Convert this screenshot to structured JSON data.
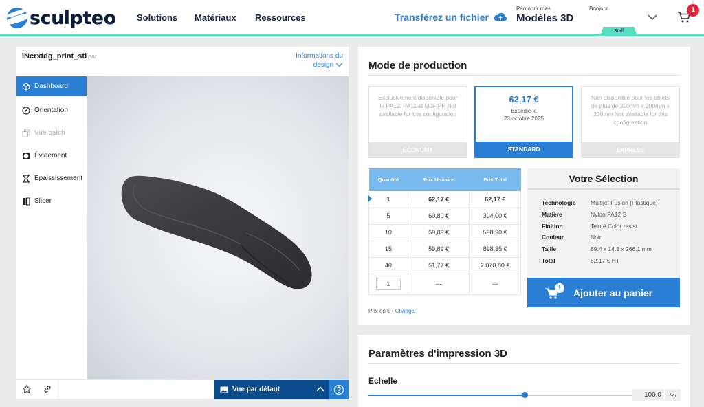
{
  "header": {
    "brand": "sculpteo",
    "nav": [
      "Solutions",
      "Matériaux",
      "Ressources"
    ],
    "upload_label": "Transférez un fichier",
    "browse_small": "Parcourir mes",
    "browse_big": "Modèles 3D",
    "greeting": "Bonjour",
    "staff_badge": "Staff",
    "cart_count": "1",
    "accent_color": "#2a7fd4",
    "header_rule_color": "#55e0c0"
  },
  "viewer": {
    "file_name": "iNcrxtdg_print_stl",
    "by_label": "par",
    "design_info": "Informations du design",
    "sidebar": [
      {
        "label": "Dashboard",
        "icon": "cube-icon",
        "state": "active"
      },
      {
        "label": "Orientation",
        "icon": "compass-icon",
        "state": "normal"
      },
      {
        "label": "Vue batch",
        "icon": "stack-icon",
        "state": "disabled"
      },
      {
        "label": "Évidement",
        "icon": "hollow-icon",
        "state": "normal"
      },
      {
        "label": "Epaississement",
        "icon": "thicken-icon",
        "state": "normal"
      },
      {
        "label": "Slicer",
        "icon": "slicer-icon",
        "state": "normal"
      }
    ],
    "view_default": "Vue par défaut"
  },
  "production": {
    "title": "Mode de production",
    "modes": [
      {
        "name": "ECONOMY",
        "desc": "Exclusivement disponible pour le PA12, PA11 et MJF PP Not available for this configuration",
        "enabled": false
      },
      {
        "name": "STANDARD",
        "price": "62,17 €",
        "ship_label": "Expédié le",
        "ship_date": "23 octobre 2025",
        "enabled": true
      },
      {
        "name": "EXPRESS",
        "desc": "Non disponible pour les objets de plus de 200mm x 200mm x 200mm Not available for this configuration",
        "enabled": false
      }
    ],
    "table_headers": [
      "Quantité",
      "Prix Unitaire",
      "Prix Total"
    ],
    "table_rows": [
      [
        "1",
        "62,17 €",
        "62,17 €"
      ],
      [
        "5",
        "60,80 €",
        "304,00 €"
      ],
      [
        "10",
        "59,89 €",
        "598,90 €"
      ],
      [
        "15",
        "59,89 €",
        "898,35 €"
      ],
      [
        "40",
        "51,77 €",
        "2 070,80 €"
      ]
    ],
    "custom_row": {
      "qty": "1",
      "unit": "---",
      "total": "---"
    },
    "price_note": "Prix en € -",
    "price_change": "Changer",
    "selection": {
      "title": "Votre Sélection",
      "rows": [
        {
          "k": "Technologie",
          "v": "Multijet Fusion (Plastique)"
        },
        {
          "k": "Matière",
          "v": "Nylon PA12 S"
        },
        {
          "k": "Finition",
          "v": "Teinté Color resist"
        },
        {
          "k": "Couleur",
          "v": "Noir"
        },
        {
          "k": "Taille",
          "v": "89.4 x 14.8 x 266.1 mm"
        },
        {
          "k": "Total",
          "v": "62.17 € HT"
        }
      ]
    },
    "add_to_cart": "Ajouter au panier",
    "add_to_cart_badge": "1"
  },
  "params": {
    "title": "Paramètres d'impression 3D",
    "scale_label": "Echelle",
    "scale_value": "100.0",
    "scale_unit": "%",
    "scale_fraction": 0.59
  }
}
